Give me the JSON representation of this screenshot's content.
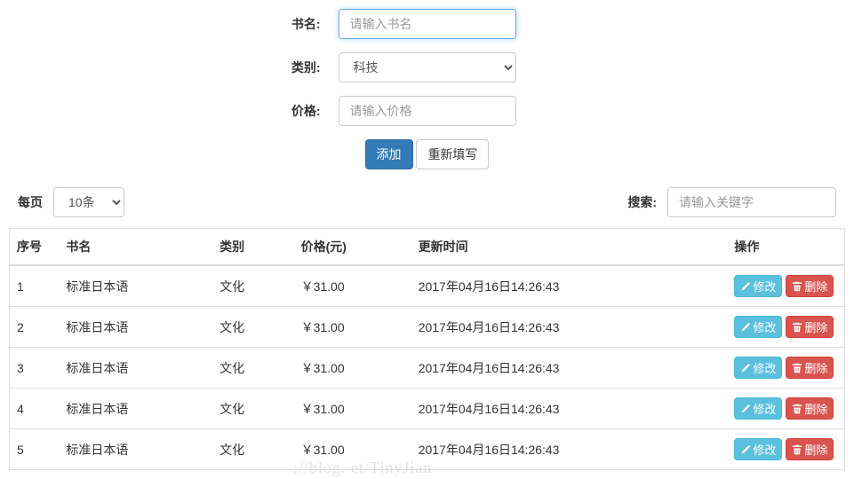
{
  "form": {
    "name_label": "书名:",
    "name_placeholder": "请输入书名",
    "category_label": "类别:",
    "category_value": "科技",
    "price_label": "价格:",
    "price_placeholder": "请输入价格",
    "submit_label": "添加",
    "reset_label": "重新填写"
  },
  "toolbar": {
    "per_page_label": "每页",
    "per_page_value": "10条",
    "search_label": "搜索:",
    "search_placeholder": "请输入关键字"
  },
  "table": {
    "headers": {
      "seq": "序号",
      "name": "书名",
      "category": "类别",
      "price": "价格(元)",
      "updated": "更新时间",
      "ops": "操作"
    },
    "ops": {
      "edit": "修改",
      "delete": "删除"
    },
    "rows": [
      {
        "seq": "1",
        "name": "标准日本语",
        "category": "文化",
        "price": "￥31.00",
        "updated": "2017年04月16日14:26:43"
      },
      {
        "seq": "2",
        "name": "标准日本语",
        "category": "文化",
        "price": "￥31.00",
        "updated": "2017年04月16日14:26:43"
      },
      {
        "seq": "3",
        "name": "标准日本语",
        "category": "文化",
        "price": "￥31.00",
        "updated": "2017年04月16日14:26:43"
      },
      {
        "seq": "4",
        "name": "标准日本语",
        "category": "文化",
        "price": "￥31.00",
        "updated": "2017年04月16日14:26:43"
      },
      {
        "seq": "5",
        "name": "标准日本语",
        "category": "文化",
        "price": "￥31.00",
        "updated": "2017年04月16日14:26:43"
      }
    ]
  },
  "watermark": "://blog.    et/TinyJian"
}
